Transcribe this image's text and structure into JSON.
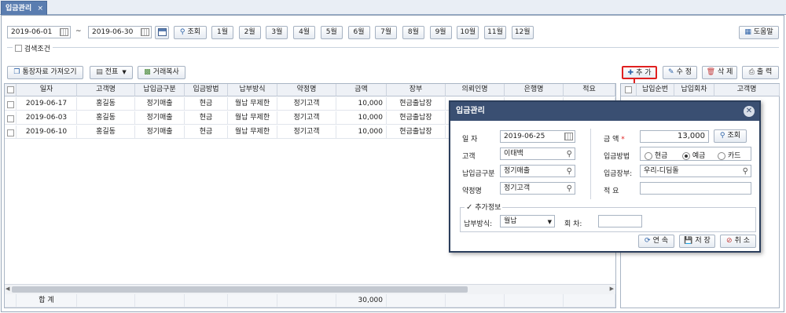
{
  "tab": {
    "title": "입금관리",
    "close": "×"
  },
  "toolbar": {
    "date_from": "2019-06-01",
    "tilde": "~",
    "date_to": "2019-06-30",
    "search_label": "조회",
    "months": [
      "1월",
      "2월",
      "3월",
      "4월",
      "5월",
      "6월",
      "7월",
      "8월",
      "9월",
      "10월",
      "11월",
      "12월"
    ],
    "help_label": "도움말"
  },
  "filter": {
    "label": "검색조건"
  },
  "actions": {
    "import_label": "통장자료 가져오기",
    "slip_label": "전표",
    "copy_label": "거래복사",
    "add_label": "추 가",
    "edit_label": "수 정",
    "delete_label": "삭 제",
    "print_label": "출 력"
  },
  "grid": {
    "columns": [
      "일자",
      "고객명",
      "납입금구분",
      "입금방법",
      "납부방식",
      "약정명",
      "금액",
      "장부",
      "의뢰인명",
      "은행명",
      "적요"
    ],
    "rows": [
      [
        "2019-06-17",
        "홍길동",
        "정기매출",
        "현금",
        "월납 무제한",
        "정기고객",
        "10,000",
        "현금출납장",
        "",
        "",
        ""
      ],
      [
        "2019-06-03",
        "홍길동",
        "정기매출",
        "현금",
        "월납 무제한",
        "정기고객",
        "10,000",
        "현금출납장",
        "",
        "",
        ""
      ],
      [
        "2019-06-10",
        "홍길동",
        "정기매출",
        "현금",
        "월납 무제한",
        "정기고객",
        "10,000",
        "현금출납장",
        "",
        "",
        ""
      ]
    ],
    "total_label": "합 계",
    "total_amount": "30,000"
  },
  "right_grid": {
    "columns": [
      "납입순번",
      "납입회차",
      "고객명"
    ]
  },
  "modal": {
    "title": "입금관리",
    "close": "✕",
    "date_label": "일 자",
    "date_value": "2019-06-25",
    "customer_label": "고객",
    "customer_value": "이태백",
    "category_label": "납입금구분",
    "category_value": "정기매출",
    "contract_label": "약정명",
    "contract_value": "정기고객",
    "amount_label": "금 액",
    "required_mark": "*",
    "amount_value": "13,000",
    "lookup_label": "조회",
    "method_label": "입금방법",
    "method_options": [
      "현금",
      "예금",
      "카드"
    ],
    "method_selected": "예금",
    "ledger_label": "입금장부:",
    "ledger_value": "우리-디딤돌",
    "memo_label": "적 요",
    "memo_value": "",
    "extra_label": "추가정보",
    "payment_type_label": "납부방식:",
    "payment_type_value": "월납",
    "round_label": "회 차:",
    "round_value": "",
    "continue_label": "연 속",
    "save_label": "저 장",
    "cancel_label": "취 소"
  }
}
